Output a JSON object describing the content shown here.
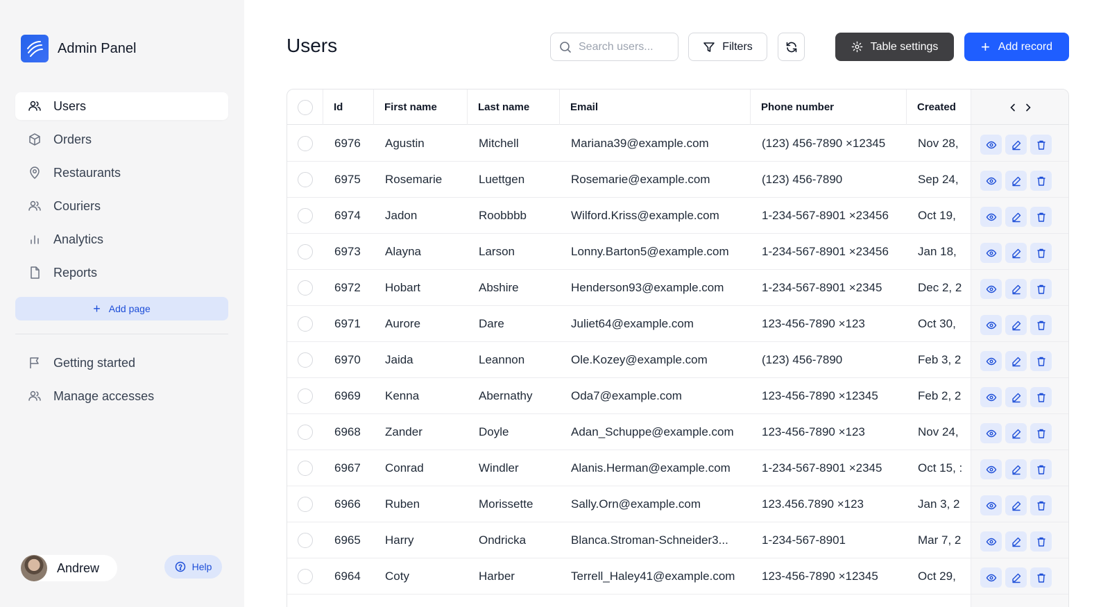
{
  "brand": {
    "title": "Admin Panel"
  },
  "sidebar": {
    "items": [
      {
        "label": "Users",
        "icon": "users-icon",
        "active": true
      },
      {
        "label": "Orders",
        "icon": "box-icon"
      },
      {
        "label": "Restaurants",
        "icon": "map-pin-icon"
      },
      {
        "label": "Couriers",
        "icon": "users-icon"
      },
      {
        "label": "Analytics",
        "icon": "bar-chart-icon"
      },
      {
        "label": "Reports",
        "icon": "file-icon"
      }
    ],
    "add_page_label": "Add page",
    "secondary": [
      {
        "label": "Getting started",
        "icon": "flag-icon"
      },
      {
        "label": "Manage accesses",
        "icon": "users-icon"
      }
    ],
    "user_name": "Andrew",
    "help_label": "Help"
  },
  "header": {
    "title": "Users",
    "search_placeholder": "Search users...",
    "filters_label": "Filters",
    "table_settings_label": "Table settings",
    "add_record_label": "Add record"
  },
  "table": {
    "columns": [
      "Id",
      "First name",
      "Last name",
      "Email",
      "Phone number",
      "Created"
    ],
    "rows": [
      [
        "6976",
        "Agustin",
        "Mitchell",
        "Mariana39@example.com",
        "(123) 456-7890 ×12345",
        "Nov 28,"
      ],
      [
        "6975",
        "Rosemarie",
        "Luettgen",
        "Rosemarie@example.com",
        "(123) 456-7890",
        "Sep 24,"
      ],
      [
        "6974",
        "Jadon",
        "Roobbbb",
        "Wilford.Kriss@example.com",
        "1-234-567-8901 ×23456",
        "Oct 19,"
      ],
      [
        "6973",
        "Alayna",
        "Larson",
        "Lonny.Barton5@example.com",
        "1-234-567-8901 ×23456",
        "Jan 18,"
      ],
      [
        "6972",
        "Hobart",
        "Abshire",
        "Henderson93@example.com",
        "1-234-567-8901 ×2345",
        "Dec 2, 2"
      ],
      [
        "6971",
        "Aurore",
        "Dare",
        "Juliet64@example.com",
        "123-456-7890 ×123",
        "Oct 30,"
      ],
      [
        "6970",
        "Jaida",
        "Leannon",
        "Ole.Kozey@example.com",
        "(123) 456-7890",
        "Feb 3, 2"
      ],
      [
        "6969",
        "Kenna",
        "Abernathy",
        "Oda7@example.com",
        "123-456-7890 ×12345",
        "Feb 2, 2"
      ],
      [
        "6968",
        "Zander",
        "Doyle",
        "Adan_Schuppe@example.com",
        "123-456-7890 ×123",
        "Nov 24,"
      ],
      [
        "6967",
        "Conrad",
        "Windler",
        "Alanis.Herman@example.com",
        "1-234-567-8901 ×2345",
        "Oct 15, :"
      ],
      [
        "6966",
        "Ruben",
        "Morissette",
        "Sally.Orn@example.com",
        "123.456.7890 ×123",
        "Jan 3, 2"
      ],
      [
        "6965",
        "Harry",
        "Ondricka",
        "Blanca.Stroman-Schneider3...",
        "1-234-567-8901",
        "Mar 7, 2"
      ],
      [
        "6964",
        "Coty",
        "Harber",
        "Terrell_Haley41@example.com",
        "123-456-7890 ×12345",
        "Oct 29,"
      ]
    ]
  },
  "colors": {
    "accent": "#1f5eff",
    "dark_button": "#3f3f42",
    "sidebar_bg": "#f5f5f6",
    "soft_accent": "#dde6fb"
  }
}
